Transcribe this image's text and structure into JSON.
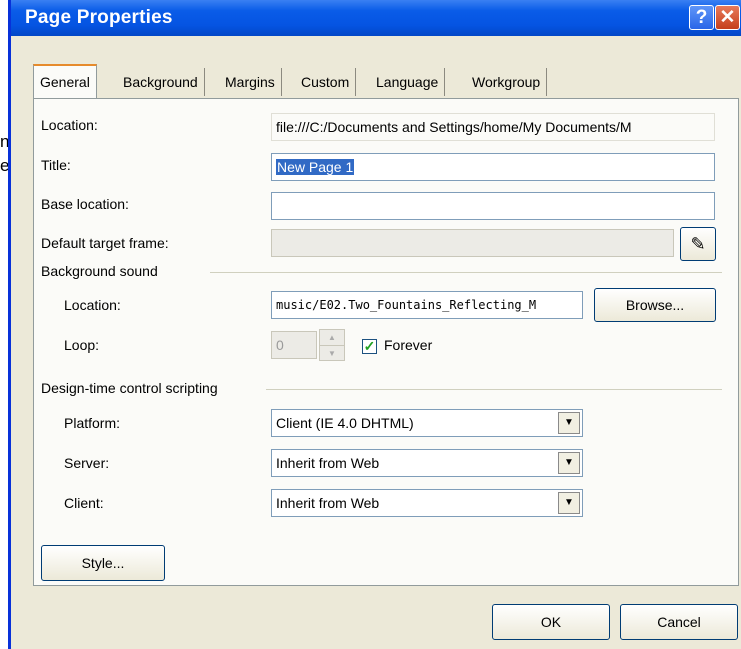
{
  "background": {
    "text": "n\ne"
  },
  "window": {
    "title": "Page Properties",
    "help_glyph": "?",
    "close_glyph": "✕"
  },
  "tabs": [
    "General",
    "Background",
    "Margins",
    "Custom",
    "Language",
    "Workgroup"
  ],
  "general": {
    "location_label": "Location:",
    "location_value": "file:///C:/Documents and Settings/home/My Documents/M",
    "title_label": "Title:",
    "title_value": "New Page 1",
    "base_location_label": "Base location:",
    "base_location_value": "",
    "default_target_label": "Default target frame:",
    "default_target_value": "",
    "pencil_glyph": "✎"
  },
  "background_sound": {
    "heading": "Background sound",
    "location_label": "Location:",
    "location_value": "music/E02.Two_Fountains_Reflecting_M",
    "browse_label": "Browse...",
    "loop_label": "Loop:",
    "loop_value": "0",
    "forever_label": "Forever",
    "forever_checked": true
  },
  "design_time": {
    "heading": "Design-time control scripting",
    "platform_label": "Platform:",
    "platform_value": "Client (IE 4.0 DHTML)",
    "server_label": "Server:",
    "server_value": "Inherit from Web",
    "client_label": "Client:",
    "client_value": "Inherit from Web"
  },
  "buttons": {
    "style": "Style...",
    "ok": "OK",
    "cancel": "Cancel"
  }
}
